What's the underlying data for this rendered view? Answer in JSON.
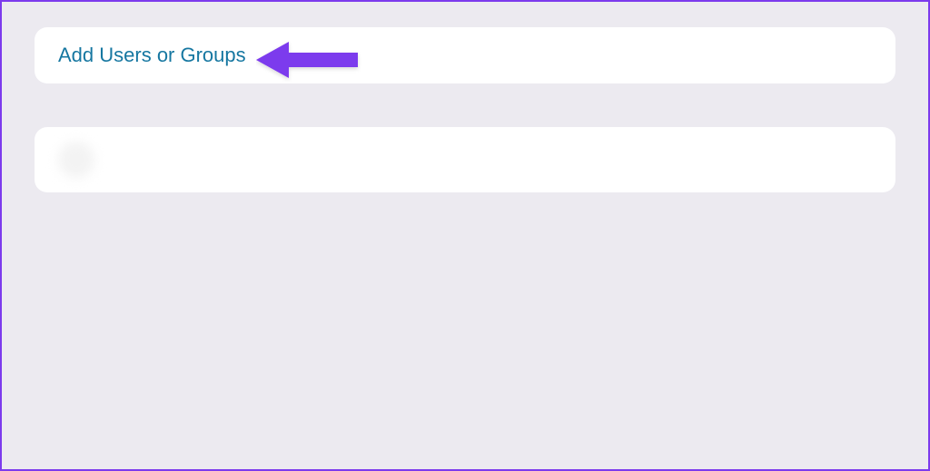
{
  "actions": {
    "add_users_or_groups_label": "Add Users or Groups"
  },
  "list": {
    "items": [
      {
        "label": ""
      }
    ]
  },
  "annotation": {
    "arrow_color": "#7c3aed"
  }
}
